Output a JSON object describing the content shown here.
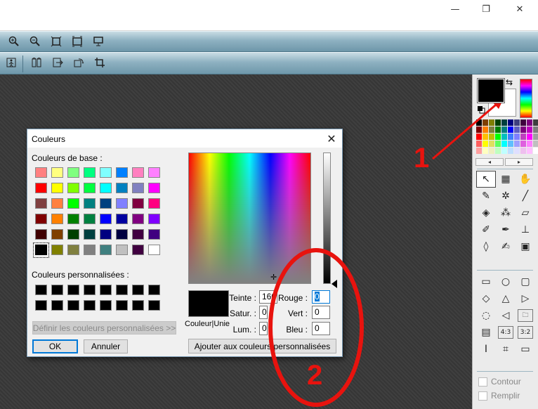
{
  "window_controls": {
    "minimize": "—",
    "maximize": "❐",
    "close": "✕"
  },
  "toolbar1": {
    "icons": [
      "zoom-in-icon",
      "zoom-out-icon",
      "fit-window-icon",
      "actual-size-icon",
      "full-screen-icon"
    ]
  },
  "toolbar2": {
    "icons": [
      "walk-icon",
      "columns-icon",
      "export-icon",
      "rotate-icon",
      "crop-icon"
    ]
  },
  "dialog": {
    "title": "Couleurs",
    "close_glyph": "✕",
    "basic_label": "Couleurs de base :",
    "basic_colors": [
      "#ff8080",
      "#ffff80",
      "#80ff80",
      "#00ff80",
      "#80ffff",
      "#0080ff",
      "#ff80c0",
      "#ff80ff",
      "#ff0000",
      "#ffff00",
      "#80ff00",
      "#00ff40",
      "#00ffff",
      "#0080c0",
      "#8080c0",
      "#ff00ff",
      "#804040",
      "#ff8040",
      "#00ff00",
      "#008080",
      "#004080",
      "#8080ff",
      "#800040",
      "#ff0080",
      "#800000",
      "#ff8000",
      "#008000",
      "#008040",
      "#0000ff",
      "#0000a0",
      "#800080",
      "#8000ff",
      "#400000",
      "#804000",
      "#004000",
      "#004040",
      "#000080",
      "#000040",
      "#400040",
      "#400080",
      "#000000",
      "#808000",
      "#808040",
      "#808080",
      "#408080",
      "#c0c0c0",
      "#400040",
      "#ffffff"
    ],
    "selected_basic_index": 40,
    "custom_label": "Couleurs personnalisées :",
    "custom_colors": [
      "#000000",
      "#000000",
      "#000000",
      "#000000",
      "#000000",
      "#000000",
      "#000000",
      "#000000",
      "#000000",
      "#000000",
      "#000000",
      "#000000",
      "#000000",
      "#000000",
      "#000000",
      "#000000"
    ],
    "define_button": "Définir les couleurs personnalisées >>",
    "ok_button": "OK",
    "cancel_button": "Annuler",
    "add_button": "Ajouter aux couleurs personnalisées",
    "preview_label": "Couleur|Unie",
    "fields": {
      "hue_label": "Teinte :",
      "hue_value": "160",
      "sat_label": "Satur. :",
      "sat_value": "0",
      "lum_label": "Lum. :",
      "lum_value": "0",
      "red_label": "Rouge :",
      "red_value": "0",
      "green_label": "Vert :",
      "green_value": "0",
      "blue_label": "Bleu :",
      "blue_value": "0"
    }
  },
  "panel": {
    "foreground_color": "#000000",
    "background_color": "#ffffff",
    "palette": [
      "#000000",
      "#7f3f00",
      "#7f7f00",
      "#003f00",
      "#003f3f",
      "#00007f",
      "#3f3f7f",
      "#3f003f",
      "#7f007f",
      "#3f3f3f",
      "#7f0000",
      "#ff7f00",
      "#7f7f3f",
      "#007f00",
      "#007f7f",
      "#0000ff",
      "#5f5fbf",
      "#7f007f",
      "#bf00bf",
      "#7f7f7f",
      "#ff0000",
      "#ffbf00",
      "#bfbf00",
      "#00ff00",
      "#00bfbf",
      "#3f7fff",
      "#7f7fff",
      "#bf3fbf",
      "#ff00ff",
      "#9f9f9f",
      "#ff5f5f",
      "#ffff00",
      "#dfdf5f",
      "#5fff5f",
      "#00ffff",
      "#5fbfff",
      "#9f9fff",
      "#df5fdf",
      "#ff7fff",
      "#bfbfbf",
      "#ff9f9f",
      "#ffffbf",
      "#efefbf",
      "#bfffbf",
      "#bfffff",
      "#bfdfff",
      "#dfdfff",
      "#efbfef",
      "#ffbfff",
      "#ffffff"
    ],
    "palette_prev": "◂",
    "palette_next": "▸",
    "tools": [
      {
        "name": "pointer-tool",
        "glyph": "↖"
      },
      {
        "name": "screen-capture-tool",
        "glyph": "▦"
      },
      {
        "name": "hand-tool",
        "glyph": "✋"
      },
      {
        "name": "eyedropper-tool",
        "glyph": "✎"
      },
      {
        "name": "magic-wand-tool",
        "glyph": "✲"
      },
      {
        "name": "line-tool",
        "glyph": "╱"
      },
      {
        "name": "fill-bucket-tool",
        "glyph": "◈"
      },
      {
        "name": "spray-tool",
        "glyph": "⁂"
      },
      {
        "name": "eraser-tool",
        "glyph": "▱"
      },
      {
        "name": "brush-tool",
        "glyph": "✐"
      },
      {
        "name": "pen-plus-tool",
        "glyph": "✒"
      },
      {
        "name": "stamp-tool",
        "glyph": "⊥"
      },
      {
        "name": "drop-tool",
        "glyph": "◊"
      },
      {
        "name": "smudge-tool",
        "glyph": "✍"
      },
      {
        "name": "portrait-tool",
        "glyph": "▣"
      }
    ],
    "shapes": [
      {
        "name": "rectangle-shape",
        "glyph": "▭"
      },
      {
        "name": "ellipse-shape",
        "glyph": "○"
      },
      {
        "name": "rounded-rect-shape",
        "glyph": "▢"
      },
      {
        "name": "diamond-shape",
        "glyph": "◇"
      },
      {
        "name": "triangle-shape",
        "glyph": "△"
      },
      {
        "name": "arrow-right-shape",
        "glyph": "▷"
      },
      {
        "name": "lasso-shape",
        "glyph": "◌"
      },
      {
        "name": "polygon-shape",
        "glyph": "◁"
      },
      {
        "name": "folder-shape",
        "glyph": "🗀"
      },
      {
        "name": "list-shape",
        "glyph": "▤"
      },
      {
        "name": "ratio-4-3",
        "glyph": "4:3"
      },
      {
        "name": "ratio-3-2",
        "glyph": "3:2"
      },
      {
        "name": "text-shape",
        "glyph": "I"
      },
      {
        "name": "crop-shape",
        "glyph": "⌗"
      },
      {
        "name": "window-shape",
        "glyph": "▭"
      }
    ],
    "outline_label": "Contour",
    "fill_label": "Remplir"
  },
  "annotations": {
    "label_1": "1",
    "label_2": "2",
    "color": "#e8130e"
  }
}
